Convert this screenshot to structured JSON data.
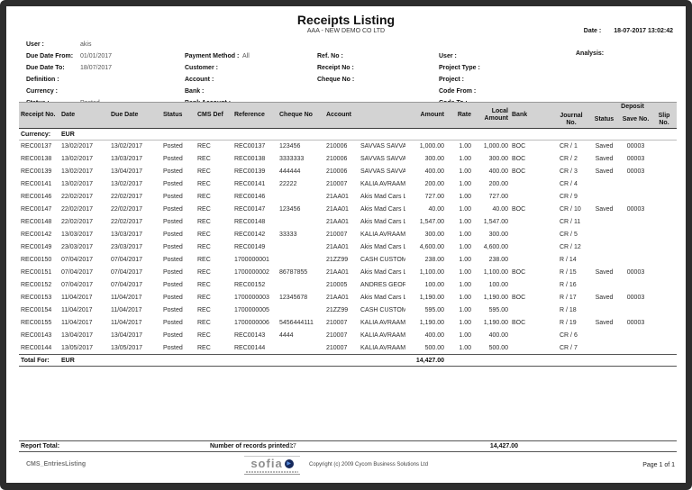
{
  "header": {
    "title": "Receipts Listing",
    "company": "AAA - NEW DEMO CO LTD",
    "date_label": "Date :",
    "date_value": "18-07-2017 13:02:42",
    "analysis_label": "Analysis:",
    "filters_left": [
      {
        "label": "User :",
        "value": "akis"
      },
      {
        "label": "Due Date From:",
        "value": "01/01/2017"
      },
      {
        "label": "Due Date To:",
        "value": "18/07/2017"
      },
      {
        "label": "Definition :",
        "value": ""
      },
      {
        "label": "Currency :",
        "value": ""
      },
      {
        "label": "Status :",
        "value": "Posted"
      }
    ],
    "filters_mid": [
      {
        "label": "Payment Method :",
        "value": "All"
      },
      {
        "label": "Customer :",
        "value": ""
      },
      {
        "label": "Account :",
        "value": ""
      },
      {
        "label": "Bank :",
        "value": ""
      },
      {
        "label": "Bank Account :",
        "value": ""
      }
    ],
    "filters_ref": [
      {
        "label": "Ref. No :",
        "value": ""
      },
      {
        "label": "Receipt No :",
        "value": ""
      },
      {
        "label": "Cheque No :",
        "value": ""
      }
    ],
    "filters_right": [
      {
        "label": "User :",
        "value": ""
      },
      {
        "label": "Project Type :",
        "value": ""
      },
      {
        "label": "Project :",
        "value": ""
      },
      {
        "label": "Code From :",
        "value": ""
      },
      {
        "label": "Code To :",
        "value": ""
      }
    ]
  },
  "table": {
    "headers": {
      "receipt_no": "Receipt No.",
      "date": "Date",
      "due_date": "Due Date",
      "status": "Status",
      "cms_def": "CMS Def",
      "reference": "Reference",
      "cheque_no": "Cheque No",
      "account": "Account",
      "amount": "Amount",
      "rate": "Rate",
      "local_amount": "Local Amount",
      "bank": "Bank",
      "journal_no": "Journal No.",
      "deposit": "Deposit",
      "dep_status": "Status",
      "save_no": "Save No.",
      "slip_no": "Slip No."
    },
    "col_keys": [
      "receipt_no",
      "date",
      "due_date",
      "status",
      "cms_def",
      "reference",
      "cheque_no",
      "account",
      "account_name",
      "amount",
      "rate",
      "local_amount",
      "bank",
      "journal_no",
      "dep_status",
      "save_no",
      "slip_no"
    ],
    "currency_label": "Currency:",
    "currency_value": "EUR",
    "rows": [
      {
        "receipt_no": "REC00137",
        "date": "13/02/2017",
        "due_date": "13/02/2017",
        "status": "Posted",
        "cms_def": "REC",
        "reference": "REC00137",
        "cheque_no": "123456",
        "account": "210006",
        "account_name": "SAVVAS SAVVA",
        "amount": "1,000.00",
        "rate": "1.00",
        "local_amount": "1,000.00",
        "bank": "BOC",
        "journal_no": "CR / 1",
        "dep_status": "Saved",
        "save_no": "00003",
        "slip_no": ""
      },
      {
        "receipt_no": "REC00138",
        "date": "13/02/2017",
        "due_date": "13/03/2017",
        "status": "Posted",
        "cms_def": "REC",
        "reference": "REC00138",
        "cheque_no": "3333333",
        "account": "210006",
        "account_name": "SAVVAS SAVVA",
        "amount": "300.00",
        "rate": "1.00",
        "local_amount": "300.00",
        "bank": "BOC",
        "journal_no": "CR / 2",
        "dep_status": "Saved",
        "save_no": "00003",
        "slip_no": ""
      },
      {
        "receipt_no": "REC00139",
        "date": "13/02/2017",
        "due_date": "13/04/2017",
        "status": "Posted",
        "cms_def": "REC",
        "reference": "REC00139",
        "cheque_no": "444444",
        "account": "210006",
        "account_name": "SAVVAS SAVVA",
        "amount": "400.00",
        "rate": "1.00",
        "local_amount": "400.00",
        "bank": "BOC",
        "journal_no": "CR / 3",
        "dep_status": "Saved",
        "save_no": "00003",
        "slip_no": ""
      },
      {
        "receipt_no": "REC00141",
        "date": "13/02/2017",
        "due_date": "13/02/2017",
        "status": "Posted",
        "cms_def": "REC",
        "reference": "REC00141",
        "cheque_no": "22222",
        "account": "210007",
        "account_name": "KALIA AVRAAM",
        "amount": "200.00",
        "rate": "1.00",
        "local_amount": "200.00",
        "bank": "",
        "journal_no": "CR / 4",
        "dep_status": "",
        "save_no": "",
        "slip_no": ""
      },
      {
        "receipt_no": "REC00146",
        "date": "22/02/2017",
        "due_date": "22/02/2017",
        "status": "Posted",
        "cms_def": "REC",
        "reference": "REC00146",
        "cheque_no": "",
        "account": "21AA01",
        "account_name": "Akis Mad Cars Lt",
        "amount": "727.00",
        "rate": "1.00",
        "local_amount": "727.00",
        "bank": "",
        "journal_no": "CR / 9",
        "dep_status": "",
        "save_no": "",
        "slip_no": ""
      },
      {
        "receipt_no": "REC00147",
        "date": "22/02/2017",
        "due_date": "22/02/2017",
        "status": "Posted",
        "cms_def": "REC",
        "reference": "REC00147",
        "cheque_no": "123456",
        "account": "21AA01",
        "account_name": "Akis Mad Cars Lt",
        "amount": "40.00",
        "rate": "1.00",
        "local_amount": "40.00",
        "bank": "BOC",
        "journal_no": "CR / 10",
        "dep_status": "Saved",
        "save_no": "00003",
        "slip_no": ""
      },
      {
        "receipt_no": "REC00148",
        "date": "22/02/2017",
        "due_date": "22/02/2017",
        "status": "Posted",
        "cms_def": "REC",
        "reference": "REC00148",
        "cheque_no": "",
        "account": "21AA01",
        "account_name": "Akis Mad Cars Lt",
        "amount": "1,547.00",
        "rate": "1.00",
        "local_amount": "1,547.00",
        "bank": "",
        "journal_no": "CR / 11",
        "dep_status": "",
        "save_no": "",
        "slip_no": ""
      },
      {
        "receipt_no": "REC00142",
        "date": "13/03/2017",
        "due_date": "13/03/2017",
        "status": "Posted",
        "cms_def": "REC",
        "reference": "REC00142",
        "cheque_no": "33333",
        "account": "210007",
        "account_name": "KALIA AVRAAM",
        "amount": "300.00",
        "rate": "1.00",
        "local_amount": "300.00",
        "bank": "",
        "journal_no": "CR / 5",
        "dep_status": "",
        "save_no": "",
        "slip_no": ""
      },
      {
        "receipt_no": "REC00149",
        "date": "23/03/2017",
        "due_date": "23/03/2017",
        "status": "Posted",
        "cms_def": "REC",
        "reference": "REC00149",
        "cheque_no": "",
        "account": "21AA01",
        "account_name": "Akis Mad Cars Lt",
        "amount": "4,600.00",
        "rate": "1.00",
        "local_amount": "4,600.00",
        "bank": "",
        "journal_no": "CR / 12",
        "dep_status": "",
        "save_no": "",
        "slip_no": ""
      },
      {
        "receipt_no": "REC00150",
        "date": "07/04/2017",
        "due_date": "07/04/2017",
        "status": "Posted",
        "cms_def": "REC",
        "reference": "1700000001",
        "cheque_no": "",
        "account": "21ZZ99",
        "account_name": "CASH CUSTOME",
        "amount": "238.00",
        "rate": "1.00",
        "local_amount": "238.00",
        "bank": "",
        "journal_no": "R / 14",
        "dep_status": "",
        "save_no": "",
        "slip_no": ""
      },
      {
        "receipt_no": "REC00151",
        "date": "07/04/2017",
        "due_date": "07/04/2017",
        "status": "Posted",
        "cms_def": "REC",
        "reference": "1700000002",
        "cheque_no": "86787855",
        "account": "21AA01",
        "account_name": "Akis Mad Cars Lt",
        "amount": "1,100.00",
        "rate": "1.00",
        "local_amount": "1,100.00",
        "bank": "BOC",
        "journal_no": "R / 15",
        "dep_status": "Saved",
        "save_no": "00003",
        "slip_no": ""
      },
      {
        "receipt_no": "REC00152",
        "date": "07/04/2017",
        "due_date": "07/04/2017",
        "status": "Posted",
        "cms_def": "REC",
        "reference": "REC00152",
        "cheque_no": "",
        "account": "210005",
        "account_name": "ANDRES GEORG",
        "amount": "100.00",
        "rate": "1.00",
        "local_amount": "100.00",
        "bank": "",
        "journal_no": "R / 16",
        "dep_status": "",
        "save_no": "",
        "slip_no": ""
      },
      {
        "receipt_no": "REC00153",
        "date": "11/04/2017",
        "due_date": "11/04/2017",
        "status": "Posted",
        "cms_def": "REC",
        "reference": "1700000003",
        "cheque_no": "12345678",
        "account": "21AA01",
        "account_name": "Akis Mad Cars Lt",
        "amount": "1,190.00",
        "rate": "1.00",
        "local_amount": "1,190.00",
        "bank": "BOC",
        "journal_no": "R / 17",
        "dep_status": "Saved",
        "save_no": "00003",
        "slip_no": ""
      },
      {
        "receipt_no": "REC00154",
        "date": "11/04/2017",
        "due_date": "11/04/2017",
        "status": "Posted",
        "cms_def": "REC",
        "reference": "1700000005",
        "cheque_no": "",
        "account": "21ZZ99",
        "account_name": "CASH CUSTOME",
        "amount": "595.00",
        "rate": "1.00",
        "local_amount": "595.00",
        "bank": "",
        "journal_no": "R / 18",
        "dep_status": "",
        "save_no": "",
        "slip_no": ""
      },
      {
        "receipt_no": "REC00155",
        "date": "11/04/2017",
        "due_date": "11/04/2017",
        "status": "Posted",
        "cms_def": "REC",
        "reference": "1700000006",
        "cheque_no": "5456444111",
        "account": "210007",
        "account_name": "KALIA AVRAAM",
        "amount": "1,190.00",
        "rate": "1.00",
        "local_amount": "1,190.00",
        "bank": "BOC",
        "journal_no": "R / 19",
        "dep_status": "Saved",
        "save_no": "00003",
        "slip_no": ""
      },
      {
        "receipt_no": "REC00143",
        "date": "13/04/2017",
        "due_date": "13/04/2017",
        "status": "Posted",
        "cms_def": "REC",
        "reference": "REC00143",
        "cheque_no": "4444",
        "account": "210007",
        "account_name": "KALIA AVRAAM",
        "amount": "400.00",
        "rate": "1.00",
        "local_amount": "400.00",
        "bank": "",
        "journal_no": "CR / 6",
        "dep_status": "",
        "save_no": "",
        "slip_no": ""
      },
      {
        "receipt_no": "REC00144",
        "date": "13/05/2017",
        "due_date": "13/05/2017",
        "status": "Posted",
        "cms_def": "REC",
        "reference": "REC00144",
        "cheque_no": "",
        "account": "210007",
        "account_name": "KALIA AVRAAM",
        "amount": "500.00",
        "rate": "1.00",
        "local_amount": "500.00",
        "bank": "",
        "journal_no": "CR / 7",
        "dep_status": "",
        "save_no": "",
        "slip_no": ""
      }
    ],
    "total_label": "Total For:",
    "total_currency": "EUR",
    "total_amount": "14,427.00"
  },
  "footer": {
    "report_total_label": "Report Total:",
    "records_label": "Number of records printed :",
    "records_value": "17",
    "report_total_amount": "14,427.00",
    "report_id": "CMS_EntriesListing",
    "logo_text": "sofia",
    "logo_icon_glyph": "▶",
    "copyright": "Copyright (c) 2009 Cycom Business Solutions Ltd",
    "page_label": "Page 1 of 1"
  }
}
